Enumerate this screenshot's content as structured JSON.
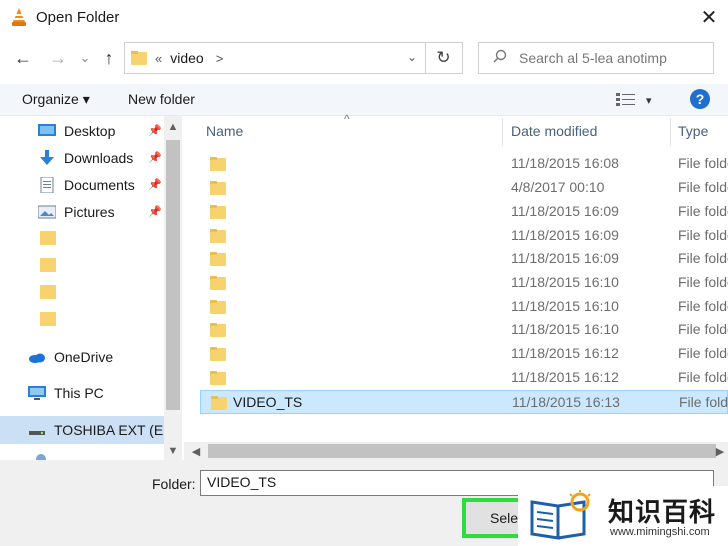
{
  "window": {
    "title": "Open Folder",
    "close_glyph": "✕"
  },
  "nav": {
    "back_glyph": "←",
    "forward_glyph": "→",
    "recent_glyph": "⌄",
    "up_glyph": "↑",
    "breadcrumb_prefix": "«",
    "breadcrumb": "video",
    "breadcrumb_arrow": ">",
    "dropdown_glyph": "⌄",
    "refresh_glyph": "↻"
  },
  "search": {
    "placeholder": "Search al 5-lea anotimp",
    "icon": "search-icon"
  },
  "toolbar": {
    "organize": "Organize ▾",
    "new_folder": "New folder",
    "view_glyph": "▾",
    "help": "?"
  },
  "sidebar": {
    "items": [
      {
        "label": "Desktop",
        "icon": "desktop-icon",
        "pinned": true
      },
      {
        "label": "Downloads",
        "icon": "downloads-icon",
        "pinned": true
      },
      {
        "label": "Documents",
        "icon": "documents-icon",
        "pinned": true
      },
      {
        "label": "Pictures",
        "icon": "pictures-icon",
        "pinned": true
      }
    ],
    "onedrive": "OneDrive",
    "this_pc": "This PC",
    "drive": "TOSHIBA EXT (E:)"
  },
  "columns": {
    "name": "Name",
    "date": "Date modified",
    "type": "Type"
  },
  "rows": [
    {
      "name": "",
      "date": "11/18/2015 16:08",
      "type": "File folder"
    },
    {
      "name": "",
      "date": "4/8/2017 00:10",
      "type": "File folder"
    },
    {
      "name": "",
      "date": "11/18/2015 16:09",
      "type": "File folder"
    },
    {
      "name": "",
      "date": "11/18/2015 16:09",
      "type": "File folder"
    },
    {
      "name": "",
      "date": "11/18/2015 16:09",
      "type": "File folder"
    },
    {
      "name": "",
      "date": "11/18/2015 16:10",
      "type": "File folder"
    },
    {
      "name": "",
      "date": "11/18/2015 16:10",
      "type": "File folder"
    },
    {
      "name": "",
      "date": "11/18/2015 16:10",
      "type": "File folder"
    },
    {
      "name": "",
      "date": "11/18/2015 16:12",
      "type": "File folder"
    },
    {
      "name": "",
      "date": "11/18/2015 16:12",
      "type": "File folder"
    },
    {
      "name": "VIDEO_TS",
      "date": "11/18/2015 16:13",
      "type": "File folder",
      "selected": true
    }
  ],
  "footer": {
    "folder_label": "Folder:",
    "folder_value": "VIDEO_TS",
    "select_button": "Select Folder"
  },
  "watermark": {
    "title": "知识百科",
    "url": "www.mimingshi.com"
  },
  "colors": {
    "accent": "#1f6fd1",
    "selection": "#cce8ff",
    "highlight_border": "#2fdc3e",
    "folder": "#f6d36e"
  }
}
